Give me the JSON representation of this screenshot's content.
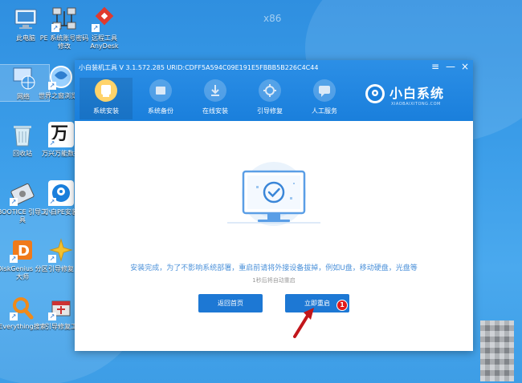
{
  "desktop": {
    "watermark": "x86",
    "icons": [
      {
        "label": "此电脑",
        "icon": "computer-icon",
        "color": "#e8f2fb"
      },
      {
        "label": "PE 系统账号密码修改",
        "icon": "network-icon",
        "color": "#d7dde3"
      },
      {
        "label": "远程工具 AnyDesk",
        "icon": "anydesk-icon",
        "color": "#e03a2e"
      },
      {
        "label": "网络",
        "icon": "network-globe-icon",
        "color": "#cfe6ff"
      },
      {
        "label": "世界之窗浏览器",
        "icon": "browser-icon",
        "color": "#9ad1ff"
      },
      {
        "label": "回收站",
        "icon": "recycle-bin-icon",
        "color": "#d8edf7"
      },
      {
        "label": "万兴万能数据",
        "icon": "wanxing-icon",
        "color": "#1a1a1a"
      },
      {
        "label": "BOOTICE 引导工具",
        "icon": "bootice-icon",
        "color": "#dfe6ee"
      },
      {
        "label": "小白PE安装",
        "icon": "xiaobai-pe-icon",
        "color": "#ffffff"
      },
      {
        "label": "DiskGenius 分区大师",
        "icon": "diskgenius-icon",
        "color": "#f07a1a"
      },
      {
        "label": "引导修复",
        "icon": "boot-repair-icon",
        "color": "#f3c12e"
      },
      {
        "label": "Everything搜索",
        "icon": "everything-icon",
        "color": "#f08a1a"
      },
      {
        "label": "引导修复工",
        "icon": "boot-repair-tool-icon",
        "color": "#e8e8e8"
      }
    ]
  },
  "window": {
    "title": "小白装机工具 V 3.1.572.285 URID:CDFF5A594C09E191E5FBBB5B226C4C44",
    "menu_glyph": "≡",
    "min_glyph": "—",
    "close_glyph": "×",
    "tabs": [
      {
        "label": "系统安装",
        "icon": "system-install-icon",
        "active": true
      },
      {
        "label": "系统备份",
        "icon": "system-backup-icon",
        "active": false
      },
      {
        "label": "在线安装",
        "icon": "online-install-icon",
        "active": false
      },
      {
        "label": "引导修复",
        "icon": "boot-repair-icon",
        "active": false
      },
      {
        "label": "人工服务",
        "icon": "chat-service-icon",
        "active": false
      }
    ],
    "brand": {
      "title": "小白系统",
      "subtitle": "XIAOBAIXITONG.COM"
    },
    "content": {
      "message": "安装完成，为了不影响系统部署，重启前请将外接设备拔掉，例如U盘，移动硬盘，光盘等",
      "countdown": "1秒后将自动重启",
      "back_button": "返回首页",
      "restart_button": "立即重启",
      "annotation_badge": "1"
    },
    "colors": {
      "header": "#1a7fdc",
      "accent_button": "#1d78d4",
      "message_text": "#4a90d9",
      "badge_red": "#e21a1a"
    }
  }
}
